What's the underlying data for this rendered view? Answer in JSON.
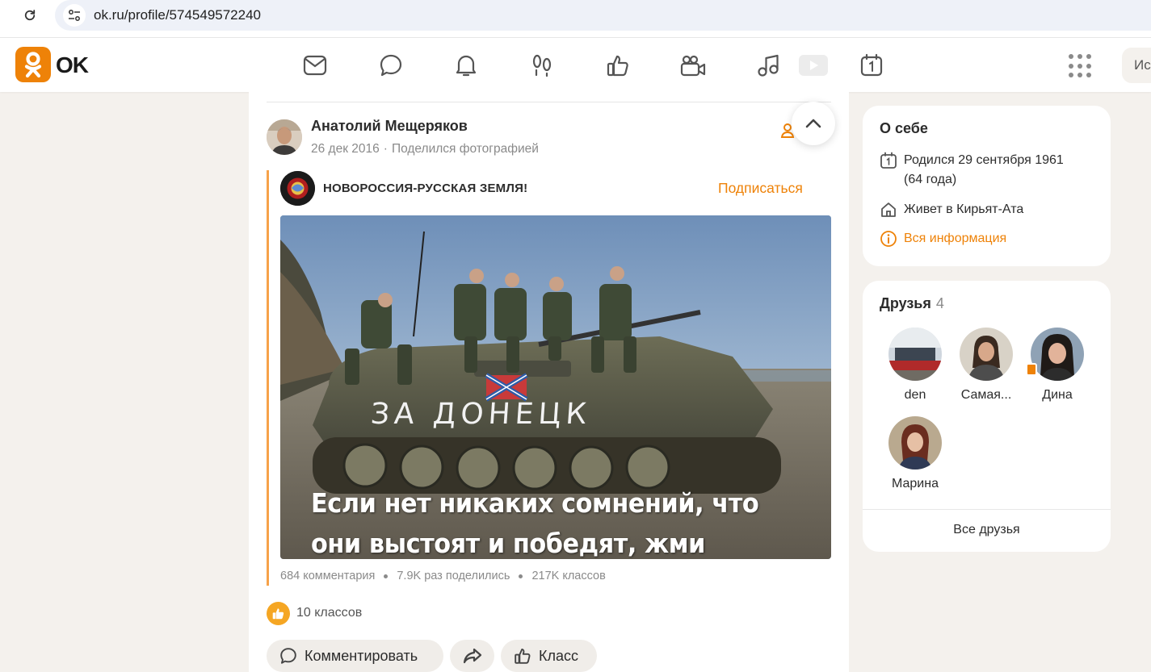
{
  "browser": {
    "url": "ok.ru/profile/574549572240"
  },
  "header": {
    "logo_text": "OK",
    "nav_icons": [
      "mail-icon",
      "chat-icon",
      "bell-icon",
      "guests-icon",
      "likes-icon",
      "camera-icon",
      "music-icon",
      "video-icon",
      "calendar-icon"
    ],
    "search_placeholder": "Ис",
    "accent_color": "#ee8208"
  },
  "post": {
    "author": "Анатолий Мещеряков",
    "date": "26 дек 2016",
    "action": "Поделился фотографией",
    "group": {
      "name": "НОВОРОССИЯ-РУССКАЯ ЗЕМЛЯ!",
      "subscribe_label": "Подписаться"
    },
    "image": {
      "tank_text": "ЗА ДОНЕЦК",
      "caption": "Если нет никаких сомнений, что они выстоят и победят, жми класс!"
    },
    "stats": {
      "comments": "684 комментария",
      "shares": "7.9K раз поделились",
      "classes": "217K классов"
    },
    "likes_text": "10 классов",
    "actions": {
      "comment": "Комментировать",
      "class": "Класс"
    }
  },
  "about": {
    "title": "О себе",
    "born_line1": "Родился 29 сентября 1961",
    "born_line2": "(64 года)",
    "lives": "Живет в Кирьят-Ата",
    "all_info": "Вся информация"
  },
  "friends": {
    "title": "Друзья",
    "count": "4",
    "items": [
      {
        "name": "den"
      },
      {
        "name": "Самая..."
      },
      {
        "name": "Дина"
      },
      {
        "name": "Марина"
      }
    ],
    "all_label": "Все друзья"
  }
}
